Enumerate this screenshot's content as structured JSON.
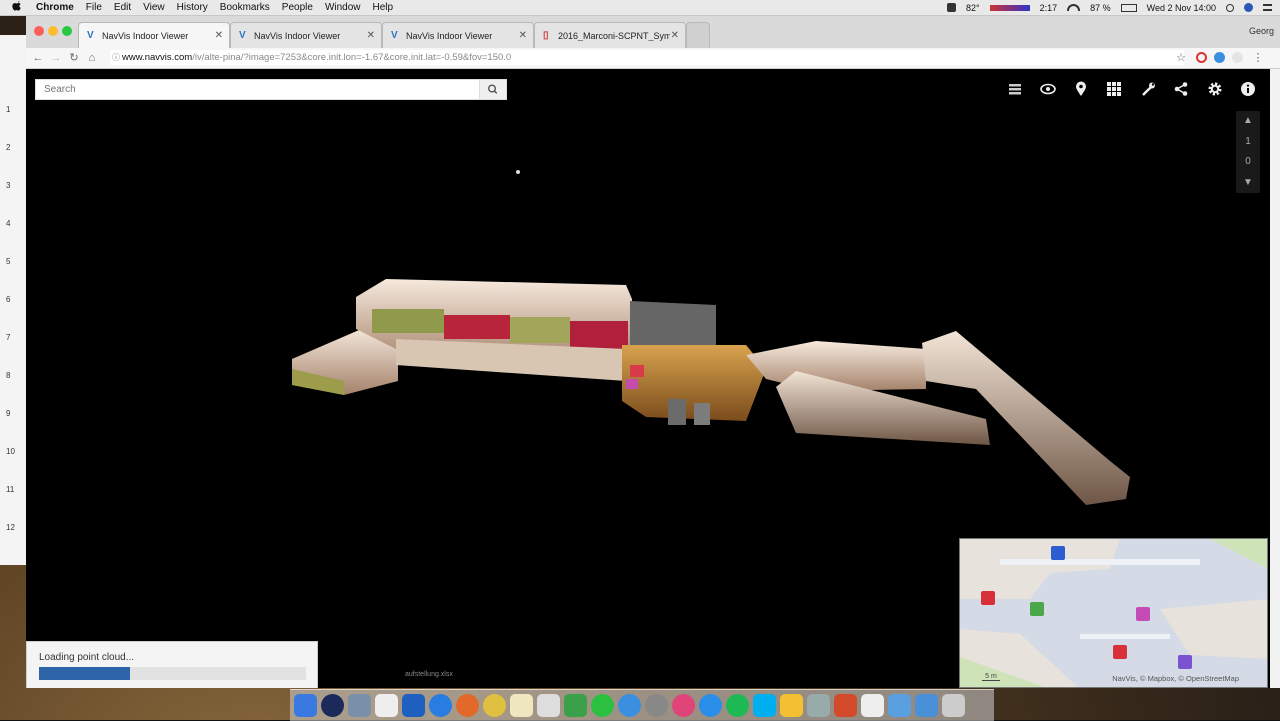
{
  "menubar": {
    "app": "Chrome",
    "items": [
      "File",
      "Edit",
      "View",
      "History",
      "Bookmarks",
      "People",
      "Window",
      "Help"
    ],
    "temperature": "82°",
    "time_small": "2:17",
    "battery": "87 %",
    "datetime": "Wed 2 Nov 14:00"
  },
  "background_window": {
    "line_numbers": [
      "1",
      "2",
      "3",
      "4",
      "5",
      "6",
      "7",
      "8",
      "9",
      "10",
      "11",
      "12"
    ]
  },
  "browser": {
    "user": "Georg",
    "tabs": [
      {
        "title": "NavVis Indoor Viewer",
        "active": true
      },
      {
        "title": "NavVis Indoor Viewer",
        "active": false
      },
      {
        "title": "NavVis Indoor Viewer",
        "active": false
      },
      {
        "title": "2016_Marconi-SCPNT_Symp...",
        "active": false
      }
    ],
    "url_host": "www.navvis.com",
    "url_path": "/iv/alte-pina/?image=7253&core.init.lon=-1.67&core.init.lat=-0.59&fov=150.0"
  },
  "viewer": {
    "search_placeholder": "Search",
    "toolbar_icons": [
      "layers-icon",
      "eye-icon",
      "location-pin-icon",
      "grid-icon",
      "wrench-icon",
      "share-icon",
      "settings-icon",
      "info-icon"
    ],
    "floor_control": {
      "up": "▲",
      "floors": [
        "1",
        "0"
      ],
      "down": "▼"
    },
    "minimap": {
      "attribution": "NavVis, © Mapbox, © OpenStreetMap",
      "scale_label": "5 m"
    },
    "loading": {
      "text": "Loading point cloud...",
      "progress": 0.34
    }
  },
  "dock": {
    "hover_label": "aufstellung.xlsx"
  },
  "colors": {
    "accent": "#2e64a8",
    "viewer_bg": "#000000"
  }
}
